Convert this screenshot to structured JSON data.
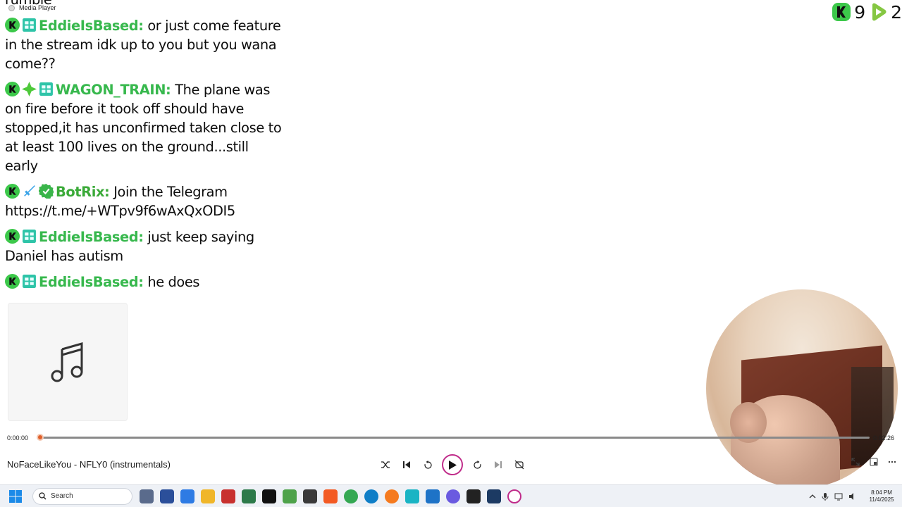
{
  "app": {
    "title": "Media Player"
  },
  "chat": {
    "partial_top": "rumble",
    "messages": [
      {
        "user": "EddieIsBased:",
        "text": "or just come feature in the stream idk up to you but you wana come??",
        "badges": [
          "kick-icon",
          "verified-box-icon"
        ]
      },
      {
        "user": "WAGON_TRAIN:",
        "text": "The plane was on fire before it took off should have stopped,it has unconfirmed taken close to at least 100 lives on the ground...still early",
        "badges": [
          "kick-icon",
          "sparkle-icon",
          "verified-box-icon"
        ]
      },
      {
        "user": "BotRix:",
        "text": "Join the Telegram https://t.me/+WTpv9f6wAxQxODI5",
        "badges": [
          "kick-icon",
          "sword-icon",
          "check-badge-icon"
        ]
      },
      {
        "user": "EddieIsBased:",
        "text": "just keep saying Daniel has autism",
        "badges": [
          "kick-icon",
          "verified-box-icon"
        ]
      },
      {
        "user": "EddieIsBased:",
        "text": "he does",
        "badges": [
          "kick-icon",
          "verified-box-icon"
        ]
      }
    ]
  },
  "stats": {
    "kick_count": "9",
    "rumble_count": "2"
  },
  "player": {
    "current_time": "0:00:00",
    "total_time": "0:02:26",
    "progress": 0.0,
    "song": "NoFaceLikeYou - NFLY0 (instrumentals)"
  },
  "taskbar": {
    "search_placeholder": "Search",
    "time": "8:04 PM",
    "date": "11/4/2025"
  },
  "colors": {
    "accent": "#e0602a",
    "username": "#37b84d",
    "play_ring": "#c02c8a"
  }
}
